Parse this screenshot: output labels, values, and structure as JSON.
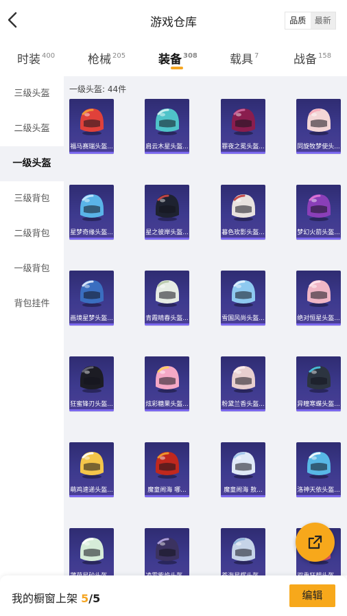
{
  "header": {
    "title": "游戏仓库",
    "sort_options": [
      "品质",
      "最新"
    ]
  },
  "tabs": [
    {
      "label": "时装",
      "count": "400"
    },
    {
      "label": "枪械",
      "count": "205"
    },
    {
      "label": "装备",
      "count": "308",
      "active": true
    },
    {
      "label": "载具",
      "count": "7"
    },
    {
      "label": "战备",
      "count": "158"
    }
  ],
  "sidebar": {
    "items": [
      {
        "label": "三级头盔"
      },
      {
        "label": "二级头盔"
      },
      {
        "label": "一级头盔",
        "active": true
      },
      {
        "label": "三级背包"
      },
      {
        "label": "二级背包"
      },
      {
        "label": "一级背包"
      },
      {
        "label": "背包挂件"
      }
    ]
  },
  "content": {
    "section_label": "一级头盔: 44件",
    "items": [
      {
        "name": "福马赛瑞头盔...",
        "color": "#e0413a",
        "accent": "#f2a03a"
      },
      {
        "name": "肩云木星头盔...",
        "color": "#4fc3c9",
        "accent": "#d8f3f3"
      },
      {
        "name": "罪夜之冕头盔...",
        "color": "#8a1d4e",
        "accent": "#d06aa0"
      },
      {
        "name": "同旋牧梦使头...",
        "color": "#f3d6d6",
        "accent": "#f7a8b8"
      },
      {
        "name": "星梦奇缘头盔...",
        "color": "#5ab4e8",
        "accent": "#c8e8ff"
      },
      {
        "name": "星之彼岸头盔...",
        "color": "#1e2230",
        "accent": "#d04848"
      },
      {
        "name": "暮色玫影头盔...",
        "color": "#e8e2df",
        "accent": "#c03a3a"
      },
      {
        "name": "梦幻火箭头盔...",
        "color": "#8a3fb8",
        "accent": "#e47ad6"
      },
      {
        "name": "画境星梦头盔...",
        "color": "#3a6ec0",
        "accent": "#e8f0ff"
      },
      {
        "name": "青霞晴春头盔...",
        "color": "#e6ece4",
        "accent": "#b6c8a6"
      },
      {
        "name": "雪国风尚头盔...",
        "color": "#8ec9f0",
        "accent": "#e8f4ff"
      },
      {
        "name": "绝对恒星头盔...",
        "color": "#f0b6c6",
        "accent": "#ffe6ee"
      },
      {
        "name": "狂蜜锋刃头盔...",
        "color": "#1c1c24",
        "accent": "#6a6a7a"
      },
      {
        "name": "炫彩糖果头盔...",
        "color": "#f4a8c6",
        "accent": "#ffd35a"
      },
      {
        "name": "粉黛兰香头盔...",
        "color": "#e8cfcf",
        "accent": "#fff0f0"
      },
      {
        "name": "异瞳寒蝶头盔...",
        "color": "#2c3440",
        "accent": "#4cc6e8"
      },
      {
        "name": "萌鸡速递头盔...",
        "color": "#f4c64a",
        "accent": "#ffffff"
      },
      {
        "name": "魔童闹海 哪...",
        "color": "#c0281e",
        "accent": "#f0a030"
      },
      {
        "name": "魔童闹海 敖...",
        "color": "#dfe9f7",
        "accent": "#9cc4ea"
      },
      {
        "name": "洛神天依头盔...",
        "color": "#58b8e6",
        "accent": "#ffffff"
      },
      {
        "name": "薄荷星砂头盔...",
        "color": "#d6ecd8",
        "accent": "#ffffff"
      },
      {
        "name": "凌霄紫焰头盔...",
        "color": "#3b3260",
        "accent": "#b8a8e8"
      },
      {
        "name": "苍海星辉头盔...",
        "color": "#c6d4e8",
        "accent": "#8ab0d8"
      },
      {
        "name": "双重狂想头盔...",
        "color": "#e85a6e",
        "accent": "#f0d040"
      }
    ]
  },
  "bottom": {
    "showcase_label": "我的橱窗上架 ",
    "showcase_current": "5",
    "showcase_separator": "/",
    "showcase_total": "5",
    "edit_label": "编辑"
  },
  "icons": {
    "back": "chevron-left-icon",
    "share": "external-link-icon"
  },
  "colors": {
    "accent": "#f7a81b",
    "item_bg": "#3d3a8e"
  }
}
